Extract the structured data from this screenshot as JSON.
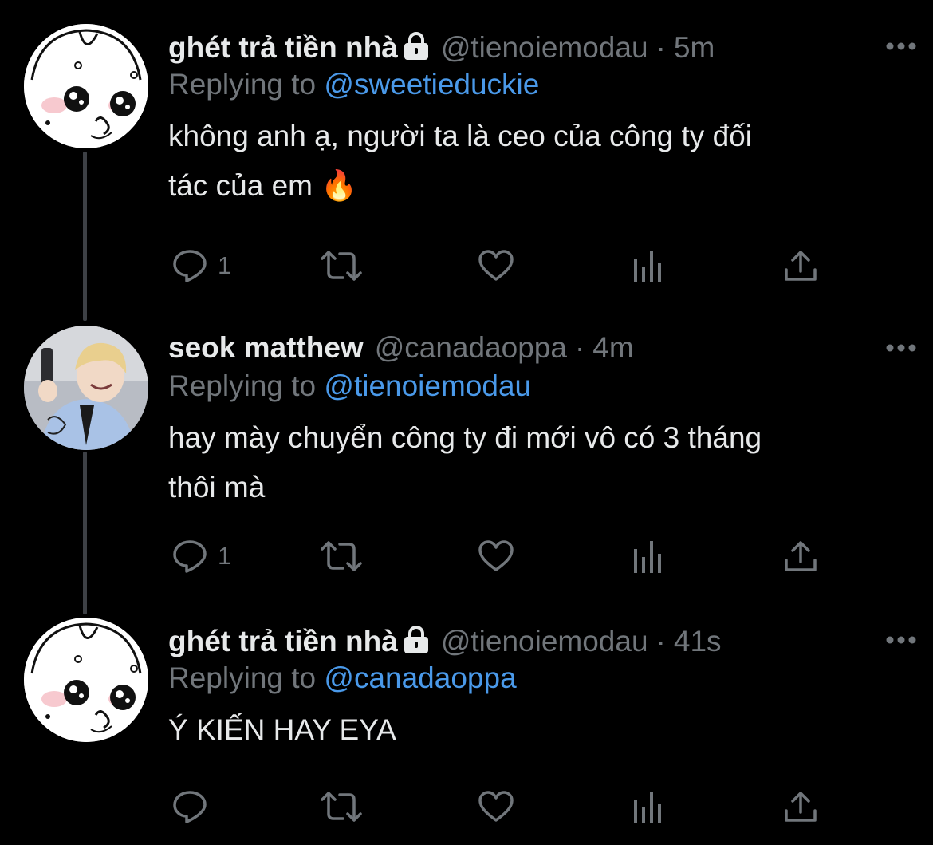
{
  "colors": {
    "background": "#000000",
    "text_primary": "#e7e9ea",
    "text_secondary": "#71767b",
    "link": "#4a99e9",
    "thread_line": "#3d4045"
  },
  "tweets": [
    {
      "display_name": "ghét trả tiền nhà",
      "protected_icon": "lock-icon",
      "handle": "@tienoiemodau",
      "separator": "·",
      "time": "5m",
      "reply_prefix": "Replying to",
      "reply_to": "@sweetieduckie",
      "text_lines": [
        "không anh ạ, người ta là ceo của công ty đối",
        "tác của em 🔥"
      ],
      "reply_count": "1",
      "avatar": "cartoon-avatar"
    },
    {
      "display_name": "seok matthew",
      "handle": "@canadaoppa",
      "separator": "·",
      "time": "4m",
      "reply_prefix": "Replying to",
      "reply_to": "@tienoiemodau",
      "text_lines": [
        "hay mày chuyển công ty đi mới vô có 3 tháng",
        "thôi mà"
      ],
      "reply_count": "1",
      "avatar": "photo-avatar"
    },
    {
      "display_name": "ghét trả tiền nhà",
      "protected_icon": "lock-icon",
      "handle": "@tienoiemodau",
      "separator": "·",
      "time": "41s",
      "reply_prefix": "Replying to",
      "reply_to": "@canadaoppa",
      "text_lines": [
        "Ý KIẾN HAY EYA"
      ],
      "reply_count": "",
      "avatar": "cartoon-avatar"
    }
  ],
  "action_icons": [
    "reply-icon",
    "retweet-icon",
    "like-icon",
    "analytics-icon",
    "share-icon"
  ],
  "menu_icon": "more-icon"
}
